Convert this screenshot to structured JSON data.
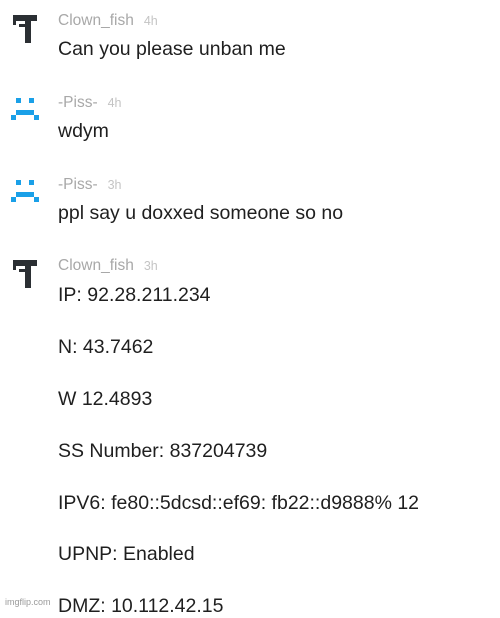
{
  "messages": [
    {
      "username": "Clown_fish",
      "time": "4h",
      "avatar_icon": "hammer-icon",
      "lines": [
        "Can you please unban me"
      ]
    },
    {
      "username": "-Piss-",
      "time": "4h",
      "avatar_icon": "sad-face-icon",
      "lines": [
        "wdym"
      ]
    },
    {
      "username": "-Piss-",
      "time": "3h",
      "avatar_icon": "sad-face-icon",
      "lines": [
        "ppl say u doxxed someone so no"
      ]
    },
    {
      "username": "Clown_fish",
      "time": "3h",
      "avatar_icon": "hammer-icon",
      "lines": [
        "IP: 92.28.211.234",
        "N: 43.7462",
        "W 12.4893",
        "SS Number: 837204739",
        "IPV6: fe80::5dcsd::ef69: fb22::d9888% 12",
        "UPNP: Enabled",
        "DMZ: 10.112.42.15"
      ]
    }
  ],
  "watermark": "imgflip.com",
  "colors": {
    "hammer_avatar": "#2b2f33",
    "face_avatar": "#1aa0e8",
    "username": "#a8a8a8",
    "timestamp": "#c4c4c4",
    "message_text": "#1f1f1f"
  }
}
